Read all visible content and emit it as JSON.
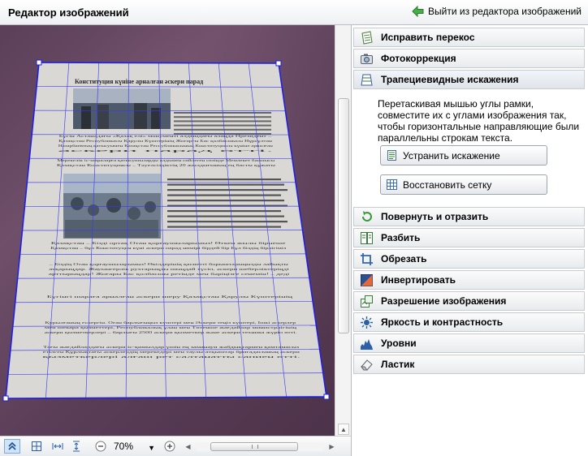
{
  "header": {
    "title": "Редактор изображений",
    "exit_label": "Выйти из редактора изображений"
  },
  "document": {
    "headline": "Конституция күніне арналған әскери парад",
    "body_lines": [
      "Бүгін Астанадағы «Қазақ елі» монументі алдындағы алаңда Президент –",
      "Қазақстан Республикасы Қарулы Күштерінің Жоғарғы Бас қолбасшысы Нұрсұлтан",
      "Назарбаевтың қатысуымен Қазақстан Республикасының Конституциясы күніне арналған",
      "әскери парад өтті.",
      "Мерекелік іс-шараларға қатысушыларды алдымен сөйлеген сөзінде Мемлекет басшысы",
      "Қазақстан Конституциясы – Тәуелсіздіктің 20 жылдығының ең басты құжаты",
      "Қазақстан – Бізді ортақ Отан қорғаушыларымыз! Өткен жылы бірнеше",
      "Қазақстан – бұл Конституция күні әскери парад нөмірі бірдей бір Бұл біздің бірлігіміз",
      "– Біздің Отан қорғаушыларымыз! Өкілдерінің қасиетті борыштарыңызды лайықты",
      "атқарыңдар. Жауынгерлік рухтарыңды шыңдай түсіп, әскери шеберліктеріңді",
      "арттырыңдар! Жоғары Бас қолбасшы ретінде мен бәріңізге сенемін! – деді",
      "Бүгінгі шараға арналған әскери шеру Қазақстан Қарулы Күштерінің",
      "Құрылғаның ескергін. Оған барлығыңыз күштері мен Әскери теңіз күштері, Ішкі әскерлер",
      "мен шекара қызметтері, Республикалық ұлан мен Төтенше жағдайлар министрлігінің",
      "әскери қызметкерлері – барлығы 2500 әскери қызметкер және әскери техника жүріп өтті.",
      "Тағы жағдайлардағы әскери іс-қимылдар үшін ең заманауи жабдықтармен қамтамасыз",
      "етілген Құрлықтағы әскерлердің мерекедері мен таулы-атқыштар бригадасының әскери",
      "қызметкерлері алғаш рет салтанатты сапиен өтті."
    ]
  },
  "tools": [
    {
      "label": "Исправить перекос",
      "icon": "deskew-icon"
    },
    {
      "label": "Фотокоррекция",
      "icon": "camera-icon"
    },
    {
      "label": "Трапециевидные искажения",
      "icon": "trapezoid-icon"
    },
    {
      "label": "Повернуть и отразить",
      "icon": "rotate-icon"
    },
    {
      "label": "Разбить",
      "icon": "split-icon"
    },
    {
      "label": "Обрезать",
      "icon": "crop-icon"
    },
    {
      "label": "Инвертировать",
      "icon": "invert-icon"
    },
    {
      "label": "Разрешение изображения",
      "icon": "resolution-icon"
    },
    {
      "label": "Яркость и контрастность",
      "icon": "brightness-icon"
    },
    {
      "label": "Уровни",
      "icon": "levels-icon"
    },
    {
      "label": "Ластик",
      "icon": "eraser-icon"
    }
  ],
  "trapezoid_panel": {
    "description": "Перетаскивая мышью углы рамки, совместите их с углами изображения так, чтобы горизонтальные направляющие были параллельны строкам текста.",
    "fix_button": "Устранить искажение",
    "grid_button": "Восстановить сетку"
  },
  "zoom": {
    "value": "70%"
  },
  "colors": {
    "frame": "#2222dd",
    "background": "#5b3f58",
    "exit_arrow": "#3aa53a"
  }
}
